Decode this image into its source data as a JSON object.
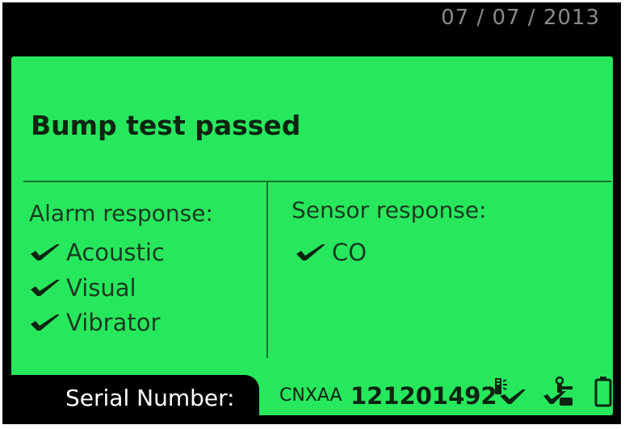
{
  "header": {
    "date": "07 / 07 / 2013"
  },
  "screen": {
    "title": "Bump test passed",
    "alarm": {
      "label": "Alarm response:",
      "items": [
        "Acoustic",
        "Visual",
        "Vibrator"
      ]
    },
    "sensor": {
      "label": "Sensor response:",
      "items": [
        "CO"
      ]
    }
  },
  "footer": {
    "serial_label": "Serial Number:",
    "serial_prefix": "CNXAA",
    "serial_number": "121201492",
    "icons": [
      "bump-test-icon",
      "calibration-icon",
      "battery-icon"
    ]
  },
  "colors": {
    "screen_bg": "#27e85d",
    "frame": "#000000",
    "text_dark": "#0c2410",
    "date_text": "#8a8a8a"
  }
}
